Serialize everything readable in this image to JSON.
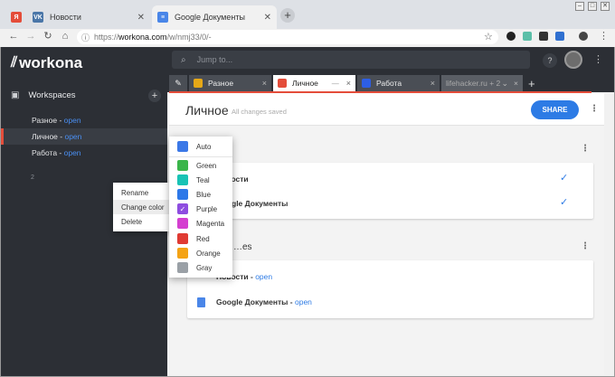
{
  "browser": {
    "tabs": [
      {
        "label": "",
        "icon": "workona-favicon",
        "color": "#e44d3a",
        "glyph": "Я"
      },
      {
        "label": "Новости",
        "icon": "vk-favicon",
        "color": "#4a76a8",
        "glyph": "VK"
      },
      {
        "label": "Google Документы",
        "icon": "docs-favicon",
        "color": "#4a86e8",
        "glyph": "≡"
      }
    ],
    "new_tab": "+",
    "url": {
      "protocol": "https://",
      "host": "workona.com",
      "path": "/w/nmj33/0/-"
    },
    "window_buttons": [
      "–",
      "□",
      "✕"
    ]
  },
  "app": {
    "logo": "workona",
    "sidebar": {
      "heading": "Workspaces",
      "add": "+",
      "workspaces": [
        {
          "name": "Разное",
          "status": "open",
          "selected": false
        },
        {
          "name": "Личное",
          "status": "open",
          "selected": true
        },
        {
          "name": "Работа",
          "status": "open",
          "selected": false
        }
      ],
      "count": "2"
    },
    "search_placeholder": "Jump to...",
    "help": "?",
    "tabs": [
      {
        "label": "",
        "icon": "pin-icon",
        "color": "#4a4e55"
      },
      {
        "label": "Разное",
        "icon": "workspace-icon",
        "color": "#e6a817",
        "active": false
      },
      {
        "label": "Личное",
        "icon": "workspace-icon",
        "color": "#e44d3a",
        "active": true
      },
      {
        "label": "Работа",
        "icon": "workspace-icon",
        "color": "#2d5ee5",
        "active": false
      },
      {
        "label": "lifehacker.ru + 2",
        "icon": "",
        "color": "#5a5e65",
        "active": false
      }
    ],
    "tab_close": "×",
    "tab_minimize": "—",
    "tab_dropdown": "⌄",
    "tab_plus": "+",
    "workspace": {
      "title": "Личное",
      "status": "All changes saved",
      "share": "SHARE",
      "section1_rows": [
        {
          "name": "Новости"
        },
        {
          "name": "Google Документы"
        }
      ],
      "section2_title": "…es",
      "section2_rows": [
        {
          "name": "Новости",
          "status": "open"
        },
        {
          "name": "Google Документы",
          "status": "open"
        }
      ]
    }
  },
  "context_menu": {
    "items": [
      "Rename",
      "Change color",
      "Delete"
    ],
    "highlighted": "Change color"
  },
  "color_menu": {
    "items": [
      {
        "label": "Auto",
        "color": "#3b78e7"
      },
      {
        "label": "Green",
        "color": "#3ab54a"
      },
      {
        "label": "Teal",
        "color": "#19c3b5"
      },
      {
        "label": "Blue",
        "color": "#2d78e8"
      },
      {
        "label": "Purple",
        "color": "#8e4de0",
        "selected": true
      },
      {
        "label": "Magenta",
        "color": "#d43fd0"
      },
      {
        "label": "Red",
        "color": "#e03a33"
      },
      {
        "label": "Orange",
        "color": "#f4a316"
      },
      {
        "label": "Gray",
        "color": "#9aa0a6"
      }
    ]
  }
}
